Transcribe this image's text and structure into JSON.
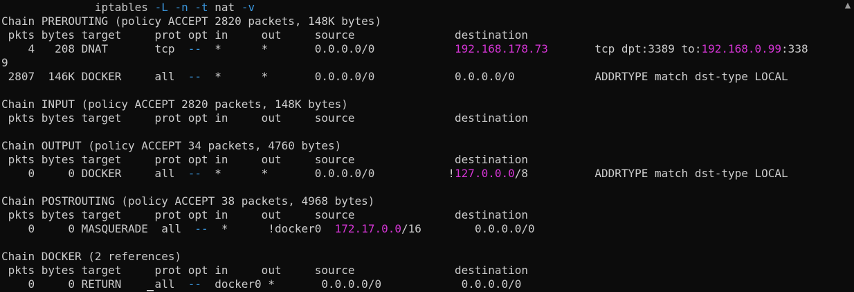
{
  "colors": {
    "background": "#0c0c0c",
    "text": "#cccccc",
    "command_flag": "#3a96dd",
    "ip_highlight": "#d535d5"
  },
  "icons": {
    "scroll_up": "▲"
  },
  "terminal": {
    "lines": [
      [
        {
          "t": "              iptables "
        },
        {
          "t": "-L",
          "c": "flag"
        },
        {
          "t": " "
        },
        {
          "t": "-n",
          "c": "flag"
        },
        {
          "t": " "
        },
        {
          "t": "-t",
          "c": "flag"
        },
        {
          "t": " nat "
        },
        {
          "t": "-v",
          "c": "flag"
        }
      ],
      [
        {
          "t": "Chain PREROUTING (policy ACCEPT 2820 packets, 148K bytes)"
        }
      ],
      [
        {
          "t": " pkts bytes target     prot opt in     out     source               destination"
        }
      ],
      [
        {
          "t": "    4   208 DNAT       tcp  "
        },
        {
          "t": "--",
          "c": "flag"
        },
        {
          "t": "  *      *       0.0.0.0/0            "
        },
        {
          "t": "192.168.178.73",
          "c": "ip"
        },
        {
          "t": "       tcp dpt:3389 to:"
        },
        {
          "t": "192.168.0.99",
          "c": "ip"
        },
        {
          "t": ":338"
        }
      ],
      [
        {
          "t": "9"
        }
      ],
      [
        {
          "t": " 2807  146K DOCKER     all  "
        },
        {
          "t": "--",
          "c": "flag"
        },
        {
          "t": "  *      *       0.0.0.0/0            0.0.0.0/0            ADDRTYPE match dst-type LOCAL"
        }
      ],
      [
        {
          "t": ""
        }
      ],
      [
        {
          "t": "Chain INPUT (policy ACCEPT 2820 packets, 148K bytes)"
        }
      ],
      [
        {
          "t": " pkts bytes target     prot opt in     out     source               destination"
        }
      ],
      [
        {
          "t": ""
        }
      ],
      [
        {
          "t": "Chain OUTPUT (policy ACCEPT 34 packets, 4760 bytes)"
        }
      ],
      [
        {
          "t": " pkts bytes target     prot opt in     out     source               destination"
        }
      ],
      [
        {
          "t": "    0     0 DOCKER     all  "
        },
        {
          "t": "--",
          "c": "flag"
        },
        {
          "t": "  *      *       0.0.0.0/0           !"
        },
        {
          "t": "127.0.0.0",
          "c": "ip"
        },
        {
          "t": "/8          ADDRTYPE match dst-type LOCAL"
        }
      ],
      [
        {
          "t": ""
        }
      ],
      [
        {
          "t": "Chain POSTROUTING (policy ACCEPT 38 packets, 4968 bytes)"
        }
      ],
      [
        {
          "t": " pkts bytes target     prot opt in     out     source               destination"
        }
      ],
      [
        {
          "t": "    0     0 MASQUERADE  all  "
        },
        {
          "t": "--",
          "c": "flag"
        },
        {
          "t": "  *      !docker0  "
        },
        {
          "t": "172.17.0.0",
          "c": "ip"
        },
        {
          "t": "/16        0.0.0.0/0"
        }
      ],
      [
        {
          "t": ""
        }
      ],
      [
        {
          "t": "Chain DOCKER (2 references)"
        }
      ],
      [
        {
          "t": " pkts bytes target     prot opt in     out     source               destination"
        }
      ],
      [
        {
          "t": "    0     0 RETURN     all  "
        },
        {
          "t": "--",
          "c": "flag"
        },
        {
          "t": "  docker0 *       0.0.0.0/0            0.0.0.0/0"
        }
      ]
    ]
  }
}
